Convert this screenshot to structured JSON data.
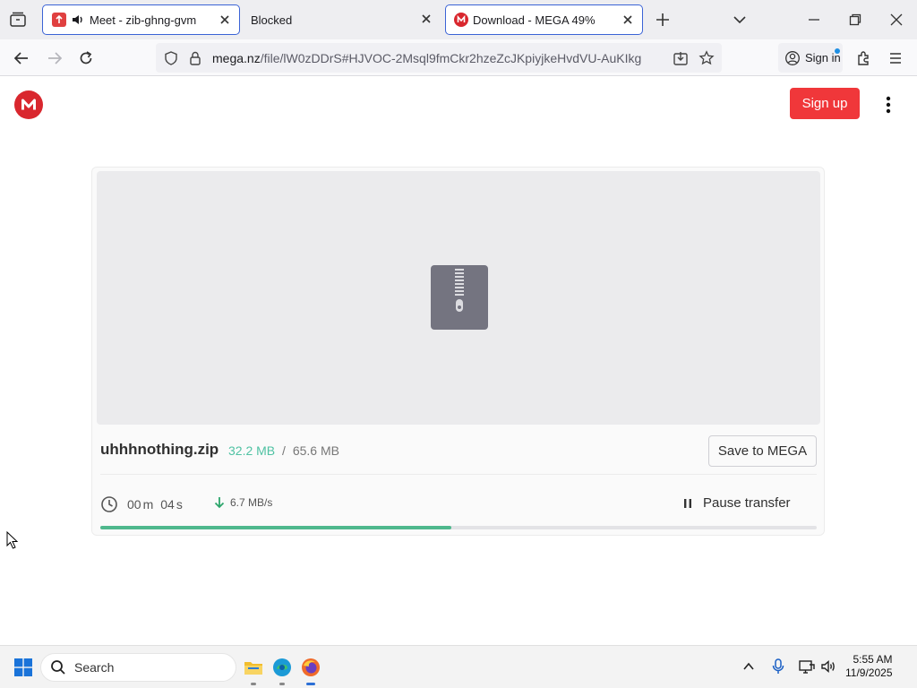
{
  "browser": {
    "tabs": [
      {
        "title": "Meet - zib-ghng-gvm",
        "audio": true
      },
      {
        "title": "Blocked"
      },
      {
        "title": "Download - MEGA 49%"
      }
    ],
    "url_host": "mega.nz",
    "url_path": "/file/lW0zDDrS#HJVOC-2Msql9fmCkr2hzeZcJKpiyjkeHvdVU-AuKIkg",
    "signin_label": "Sign in"
  },
  "page": {
    "brand_letter": "M",
    "signup_label": "Sign up",
    "file": {
      "name": "uhhhnothing.zip",
      "downloaded": "32.2 MB",
      "separator": "/",
      "total": "65.6 MB"
    },
    "save_label": "Save to MEGA",
    "timer": {
      "minutes": "00",
      "m_unit": "m",
      "seconds": "04",
      "s_unit": "s"
    },
    "speed": "6.7 MB/s",
    "pause_label": "Pause transfer",
    "progress_fraction": 0.49,
    "colors": {
      "accent_red": "#f0373a",
      "brand_red": "#d9272e",
      "progress_green": "#4fb88d",
      "size_green": "#4fc2a3"
    }
  },
  "taskbar": {
    "search_placeholder": "Search",
    "time": "5:55 AM",
    "date": "11/9/2025"
  }
}
